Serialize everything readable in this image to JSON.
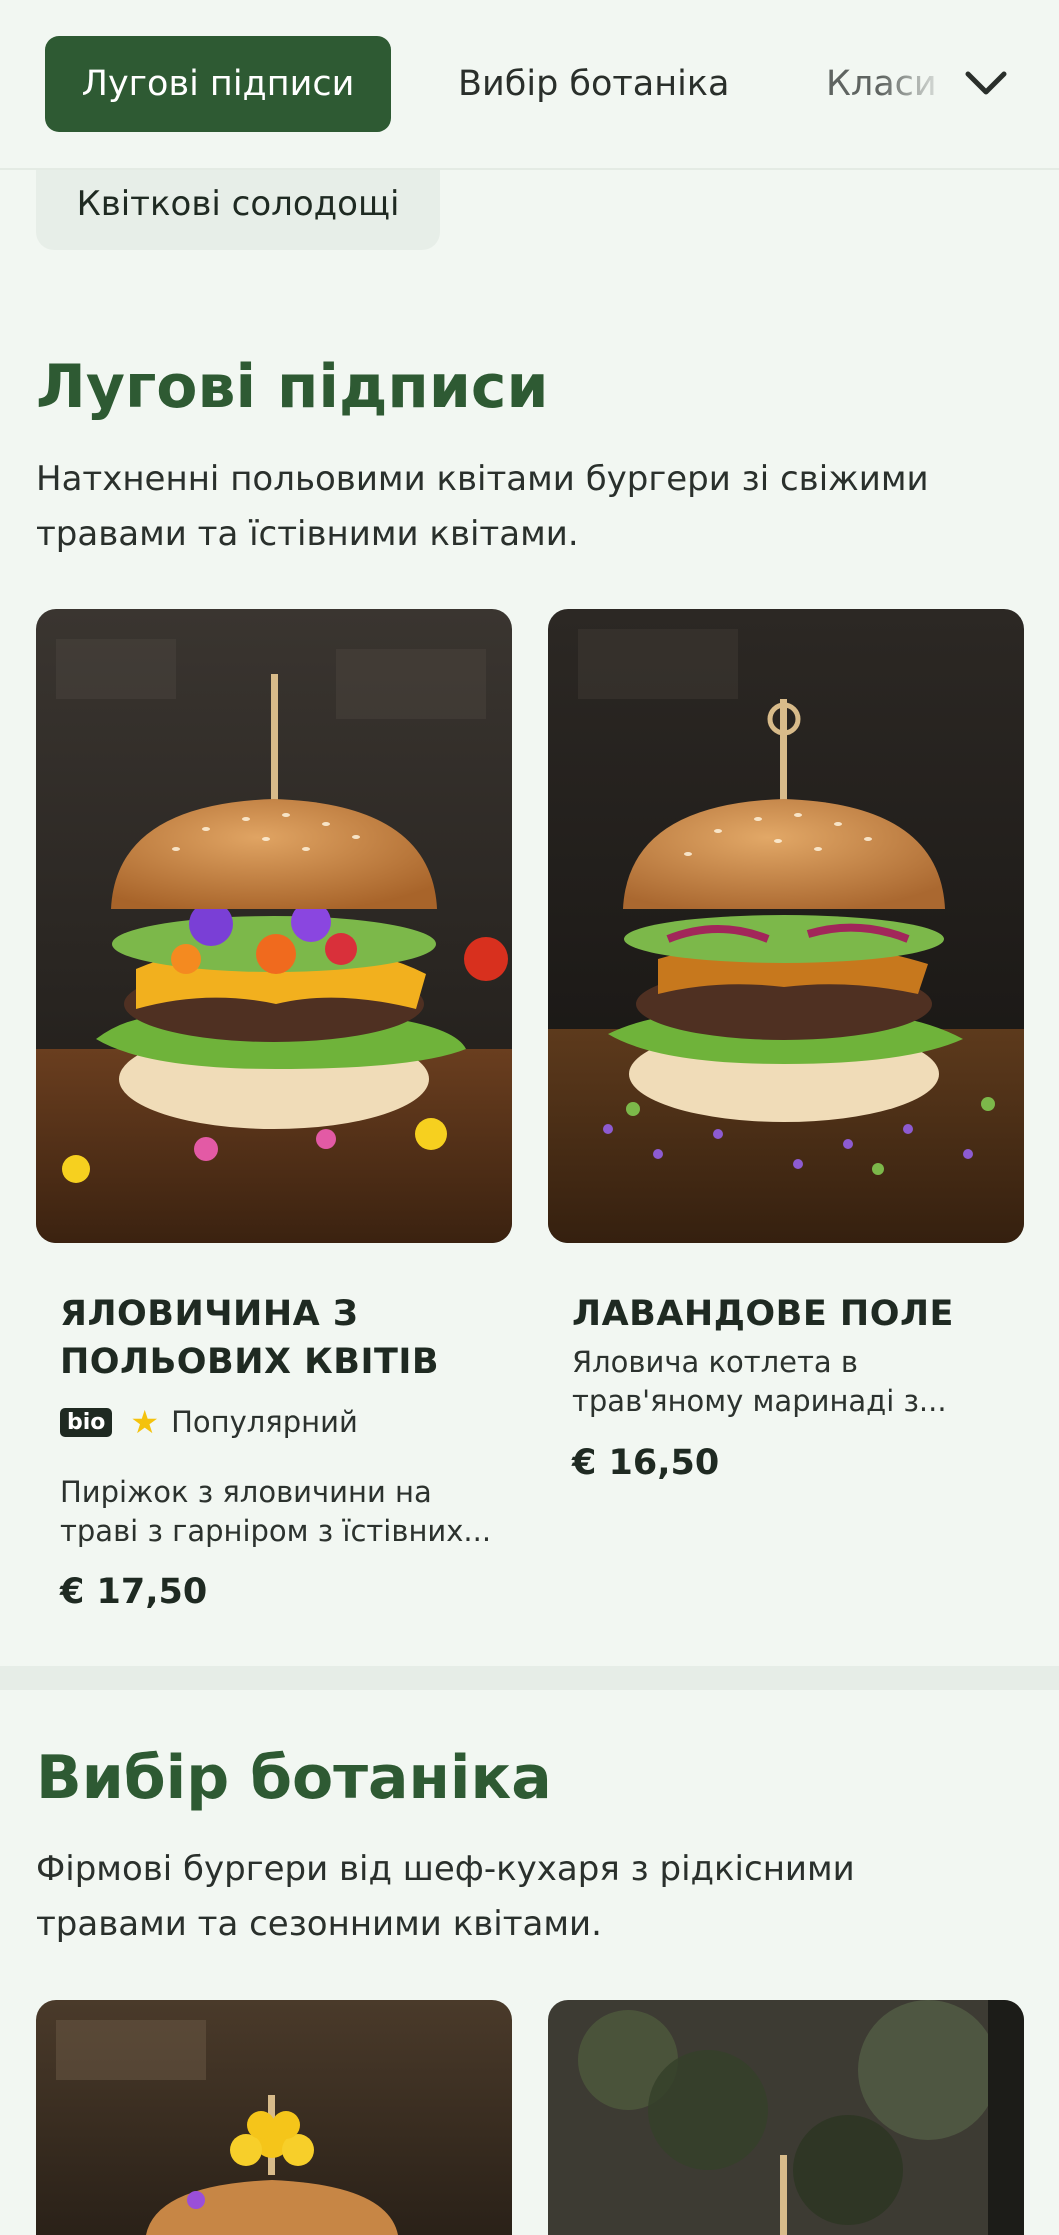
{
  "nav": {
    "tabs": [
      "Лугові підписи",
      "Вибір ботаніка",
      "Класи"
    ],
    "active_index": 0,
    "more_icon": "chevron-down-icon"
  },
  "chip": {
    "label": "Квіткові солодощі"
  },
  "sections": [
    {
      "title": "Лугові підписи",
      "description": "Натхненні польовими квітами бургери зі свіжими травами та їстівними квітами.",
      "products": [
        {
          "name": "ЯЛОВИЧИНА З ПОЛЬОВИХ КВІТІВ",
          "badges": {
            "bio": "bio",
            "popular": "Популярний"
          },
          "description": "Пиріжок з яловичини на траві з гарніром з їстівних...",
          "price": "€ 17,50"
        },
        {
          "name": "ЛАВАНДОВЕ ПОЛЕ",
          "description": "Яловича котлета в трав'яному маринаді з...",
          "price": "€ 16,50"
        }
      ]
    },
    {
      "title": "Вибір ботаніка",
      "description": "Фірмові бургери від шеф-кухаря з рідкісними травами та сезонними квітами."
    }
  ],
  "colors": {
    "accent": "#2e5a33",
    "background": "#f2f7f2",
    "star": "#f4c20d"
  }
}
